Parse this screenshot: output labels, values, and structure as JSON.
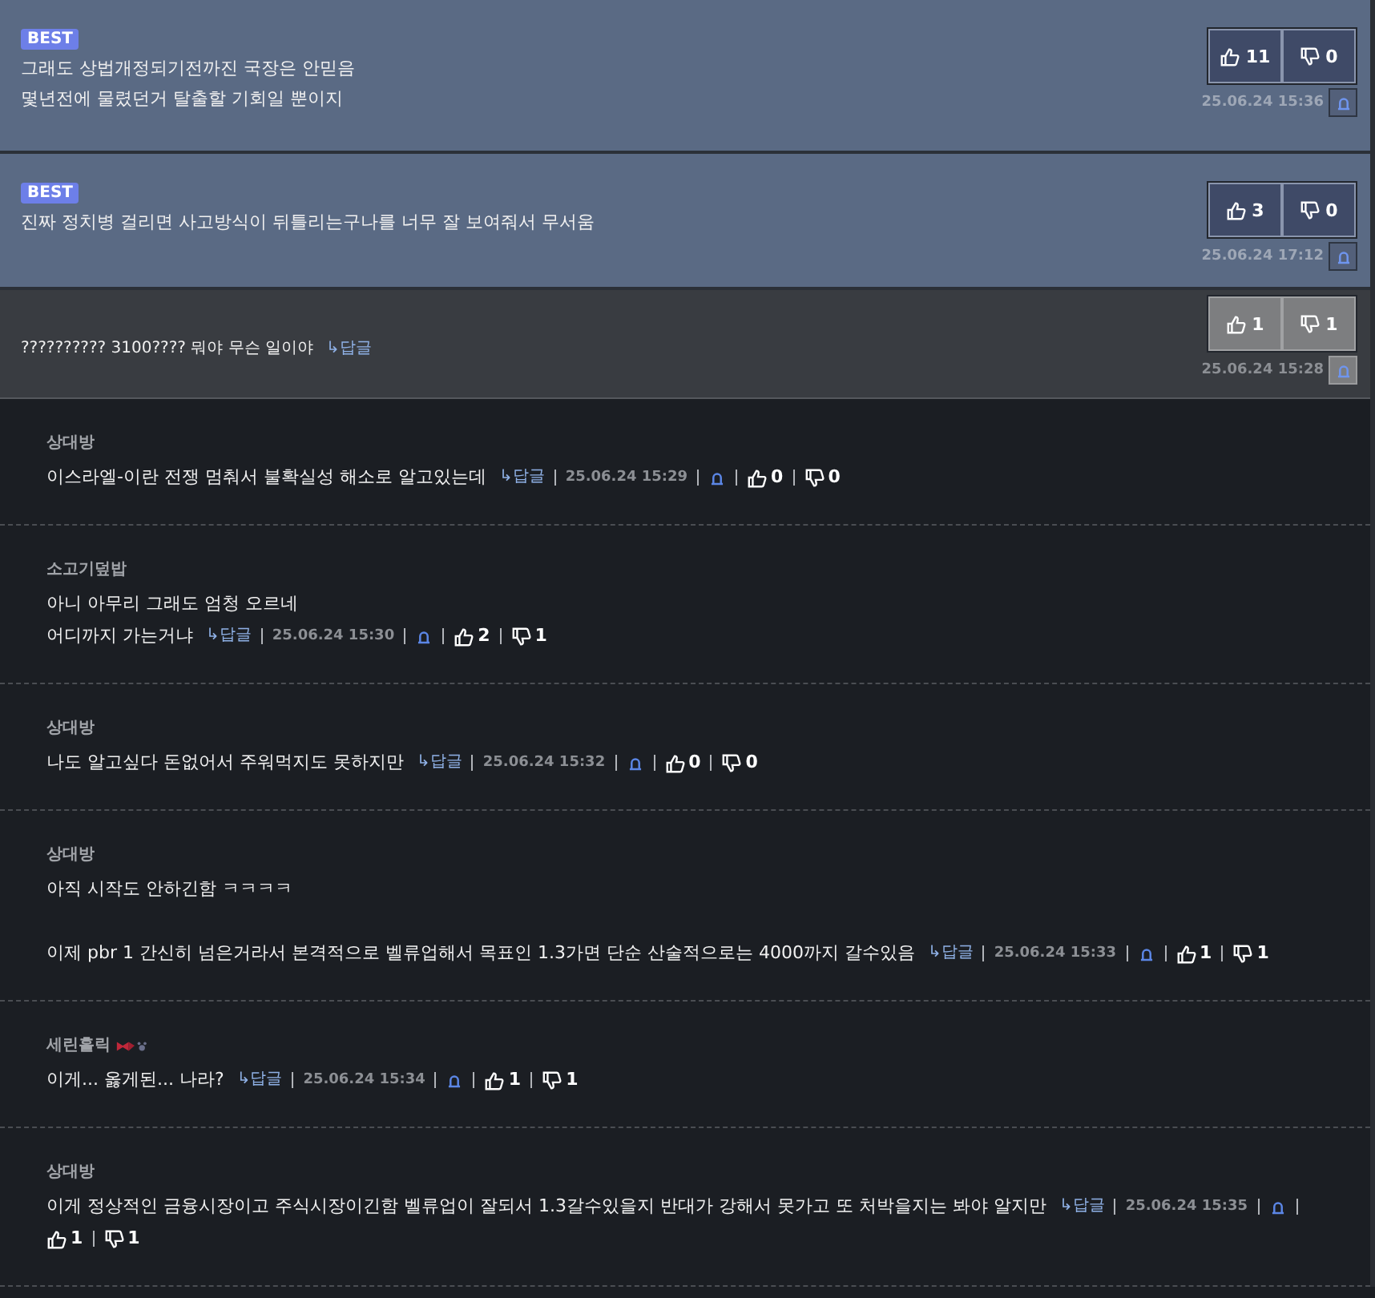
{
  "comments": [
    {
      "kind": "best",
      "badge": "BEST",
      "paragraphs": [
        [
          "그래도 상법개정되기전까진 국장은 안믿음",
          "몇년전에 물렸던거 탈출할 기회일 뿐이지"
        ]
      ],
      "up": "11",
      "down": "0",
      "time": "25.06.24 15:36"
    },
    {
      "kind": "best",
      "badge": "BEST",
      "paragraphs": [
        [
          "진짜 정치병 걸리면 사고방식이 뒤틀리는구나를 너무 잘 보여줘서 무서움"
        ]
      ],
      "up": "3",
      "down": "0",
      "time": "25.06.24 17:12"
    },
    {
      "kind": "main",
      "paragraphs": [
        [
          "?????????? 3100???? 뭐야 무슨 일이야"
        ]
      ],
      "reply": "↳답글",
      "up": "1",
      "down": "1",
      "time": "25.06.24 15:28"
    },
    {
      "kind": "reply",
      "author": "상대방",
      "paragraphs": [
        [
          "이스라엘-이란 전쟁 멈춰서 불확실성 해소로 알고있는데"
        ]
      ],
      "reply": "↳답글",
      "time": "25.06.24 15:29",
      "up": "0",
      "down": "0"
    },
    {
      "kind": "reply",
      "author": "소고기덮밥",
      "paragraphs": [
        [
          "아니 아무리 그래도 엄청 오르네",
          "어디까지 가는거냐"
        ]
      ],
      "reply": "↳답글",
      "time": "25.06.24 15:30",
      "up": "2",
      "down": "1"
    },
    {
      "kind": "reply",
      "author": "상대방",
      "paragraphs": [
        [
          "나도 알고싶다 돈없어서 주워먹지도 못하지만"
        ]
      ],
      "reply": "↳답글",
      "time": "25.06.24 15:32",
      "up": "0",
      "down": "0"
    },
    {
      "kind": "reply",
      "author": "상대방",
      "paragraphs": [
        [
          "아직 시작도 안하긴함 ㅋㅋㅋㅋ"
        ],
        [
          "이제 pbr 1 간신히 넘은거라서 본격적으로 벨류업해서 목표인 1.3가면 단순 산술적으로는 4000까지 갈수있음"
        ]
      ],
      "reply": "↳답글",
      "time": "25.06.24 15:33",
      "up": "1",
      "down": "1"
    },
    {
      "kind": "reply",
      "author": "세린홀릭",
      "author_icons": true,
      "paragraphs": [
        [
          "이게... 옳게된... 나라?"
        ]
      ],
      "reply": "↳답글",
      "time": "25.06.24 15:34",
      "up": "1",
      "down": "1"
    },
    {
      "kind": "reply",
      "author": "상대방",
      "paragraphs": [
        [
          "이게 정상적인 금융시장이고 주식시장이긴함 벨류업이 잘되서 1.3갈수있을지 반대가 강해서 못가고 또 처박을지는 봐야 알지만"
        ]
      ],
      "reply": "↳답글",
      "time": "25.06.24 15:35",
      "up": "1",
      "down": "1"
    }
  ]
}
